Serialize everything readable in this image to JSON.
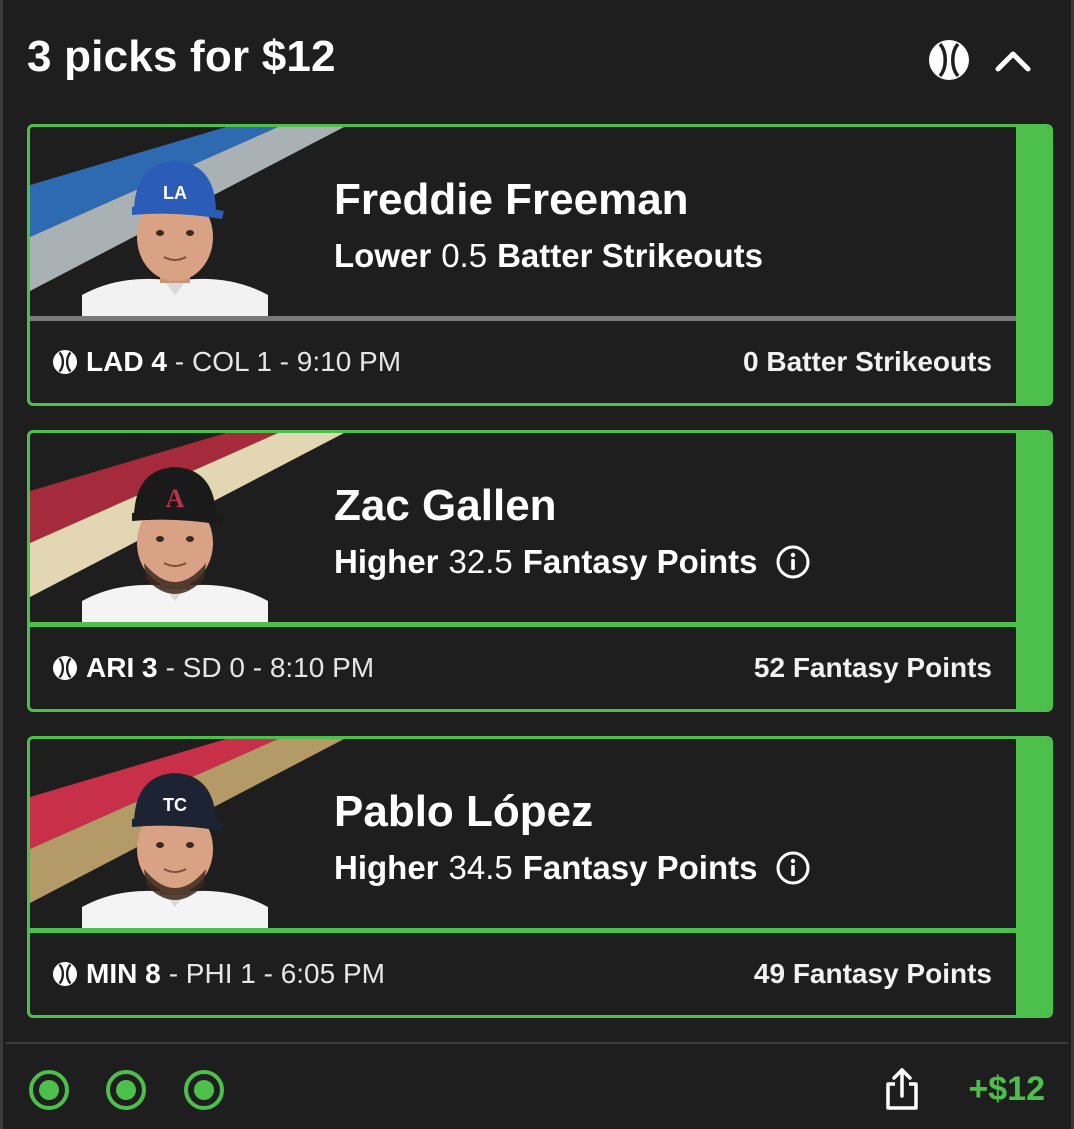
{
  "header": {
    "title": "3 picks for $12",
    "sport_icon": "baseball-icon",
    "collapse_icon": "chevron-up-icon"
  },
  "picks": [
    {
      "player_name": "Freddie Freeman",
      "direction": "Lower",
      "line": "0.5",
      "stat": "Batter Strikeouts",
      "has_info_icon": false,
      "team_score": "LAD 4",
      "opponent_time": "- COL 1 - 9:10 PM",
      "result": "0 Batter Strikeouts",
      "stripe_colors": [
        "#2e6ab2",
        "#a9b1b5"
      ],
      "divider_color": "#7a7a7a",
      "cap_color": "#2a5cb8",
      "cap_logo": "LA",
      "logo_color": "#ffffff",
      "jersey_color": "#f2f2f2"
    },
    {
      "player_name": "Zac Gallen",
      "direction": "Higher",
      "line": "32.5",
      "stat": "Fantasy Points",
      "has_info_icon": true,
      "team_score": "ARI 3",
      "opponent_time": "- SD 0 - 8:10 PM",
      "result": "52 Fantasy Points",
      "stripe_colors": [
        "#a42a3c",
        "#e3d6b2"
      ],
      "divider_color": "#4cc04a",
      "cap_color": "#1a1a1a",
      "cap_logo": "A",
      "logo_color": "#b8324a",
      "jersey_color": "#f4f4f4"
    },
    {
      "player_name": "Pablo López",
      "direction": "Higher",
      "line": "34.5",
      "stat": "Fantasy Points",
      "has_info_icon": true,
      "team_score": "MIN 8",
      "opponent_time": "- PHI 1 - 6:05 PM",
      "result": "49 Fantasy Points",
      "stripe_colors": [
        "#c8304a",
        "#b49a66"
      ],
      "divider_color": "#4cc04a",
      "cap_color": "#1c2433",
      "cap_logo": "TC",
      "logo_color": "#ffffff",
      "jersey_color": "#f4f4f4"
    }
  ],
  "footer": {
    "status_dots": [
      "win",
      "win",
      "win"
    ],
    "share_icon": "share-icon",
    "payout": "+$12"
  },
  "colors": {
    "accent": "#4cc04a",
    "background": "#1e1e1e",
    "text": "#ffffff"
  }
}
